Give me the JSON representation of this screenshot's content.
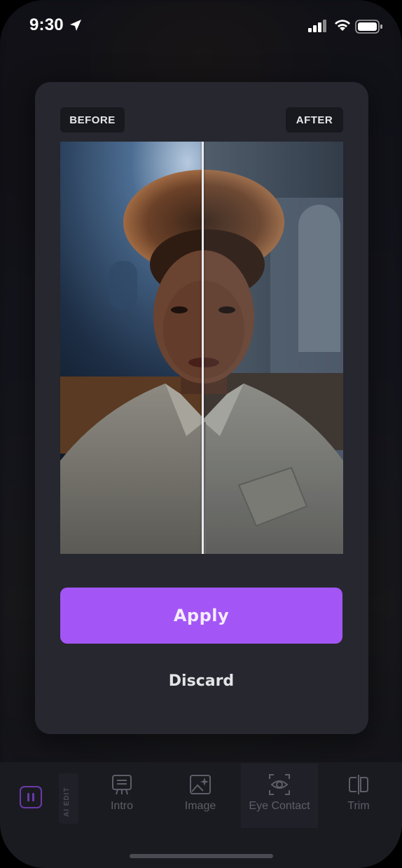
{
  "status_bar": {
    "time": "9:30",
    "icons": [
      "location-arrow-icon",
      "signal-icon",
      "wifi-icon",
      "battery-icon"
    ]
  },
  "modal": {
    "before_label": "BEFORE",
    "after_label": "AFTER",
    "apply_label": "Apply",
    "discard_label": "Discard",
    "accent_color": "#a356f5"
  },
  "toolbar": {
    "ai_edit_label": "AI EDIT",
    "items": [
      {
        "label": "Intro",
        "icon": "intro-icon"
      },
      {
        "label": "Image",
        "icon": "image-sparkle-icon"
      },
      {
        "label": "Eye Contact",
        "icon": "eye-contact-icon"
      },
      {
        "label": "Trim",
        "icon": "trim-icon"
      }
    ]
  }
}
